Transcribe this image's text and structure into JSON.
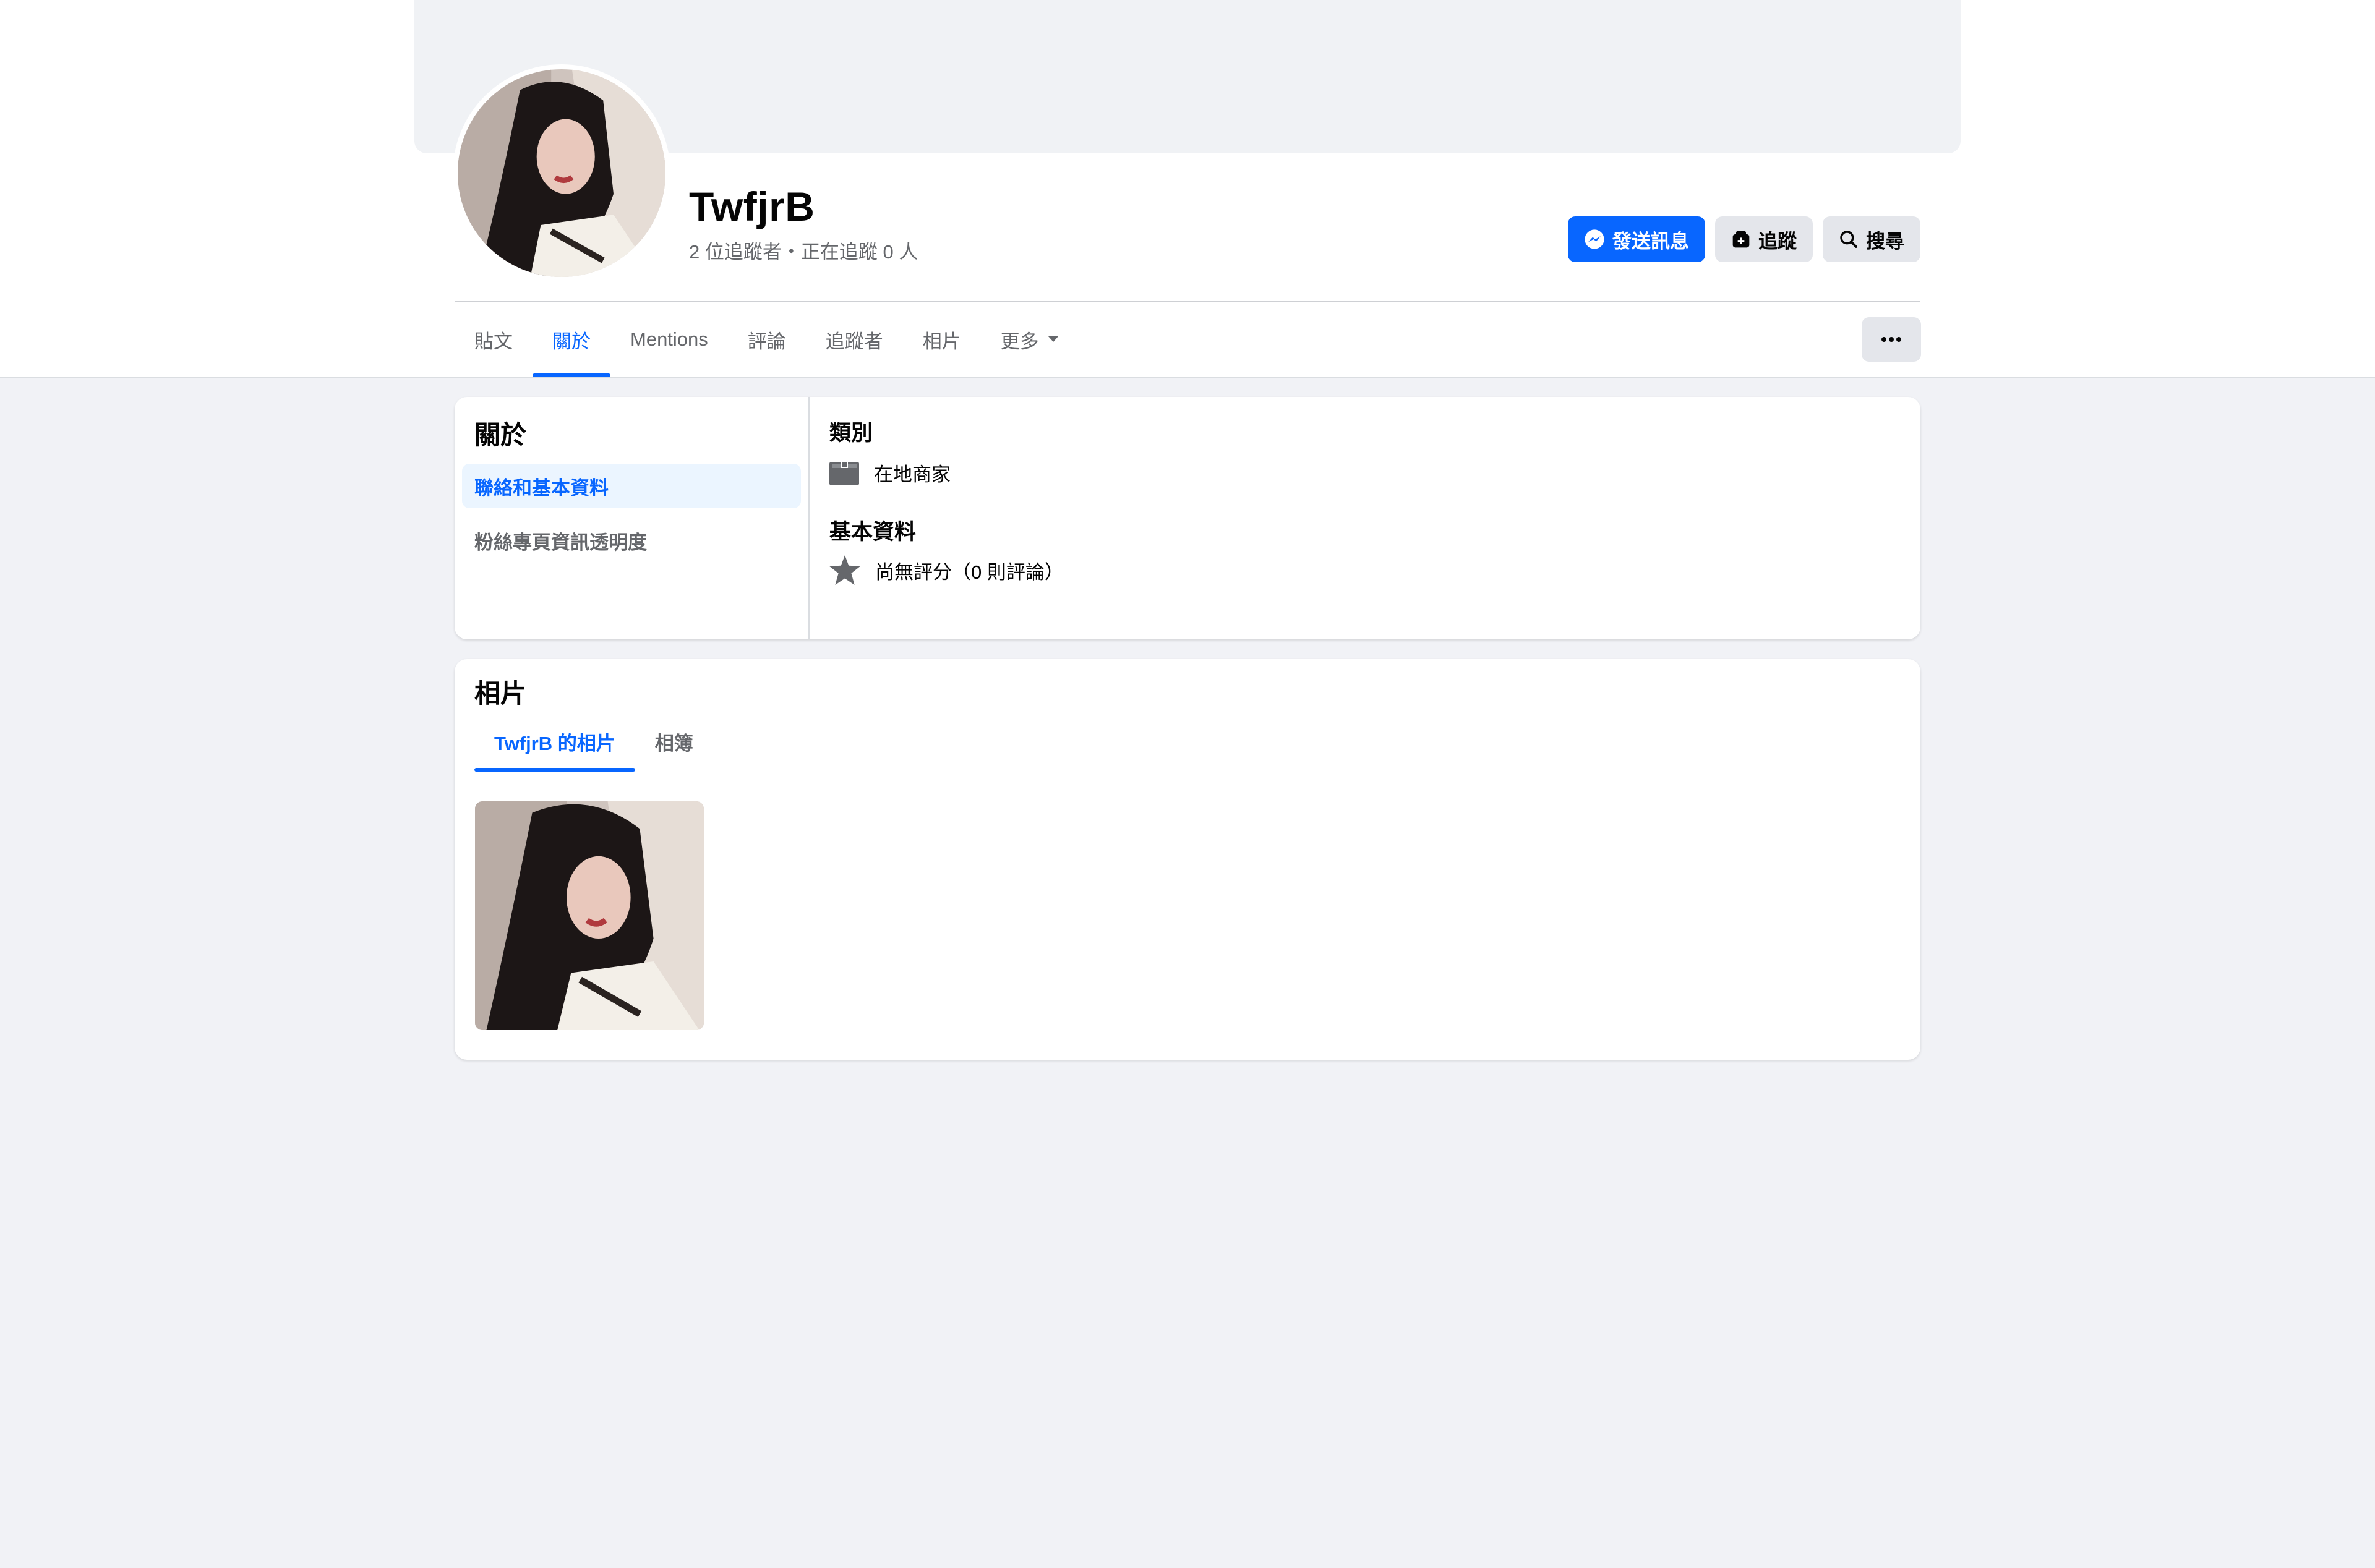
{
  "profile": {
    "name": "TwfjrB",
    "stats": "2 位追蹤者・正在追蹤 0 人"
  },
  "actions": {
    "message_label": "發送訊息",
    "follow_label": "追蹤",
    "search_label": "搜尋"
  },
  "tabs": [
    {
      "label": "貼文",
      "active": false
    },
    {
      "label": "關於",
      "active": true
    },
    {
      "label": "Mentions",
      "active": false
    },
    {
      "label": "評論",
      "active": false
    },
    {
      "label": "追蹤者",
      "active": false
    },
    {
      "label": "相片",
      "active": false
    },
    {
      "label": "更多",
      "active": false
    }
  ],
  "about": {
    "title": "關於",
    "nav": [
      {
        "label": "聯絡和基本資料",
        "active": true
      },
      {
        "label": "粉絲專頁資訊透明度",
        "active": false
      }
    ],
    "category_title": "類別",
    "category_value": "在地商家",
    "basic_title": "基本資料",
    "rating_value": "尚無評分（0 則評論）"
  },
  "photos": {
    "title": "相片",
    "tabs": [
      {
        "label": "TwfjrB 的相片",
        "active": true
      },
      {
        "label": "相簿",
        "active": false
      }
    ]
  },
  "colors": {
    "accent": "#0866ff",
    "page_bg": "#f1f2f6",
    "text_secondary": "#65676b"
  },
  "icons": {
    "message": "messenger-icon",
    "follow": "follow-icon",
    "search": "search-icon",
    "more": "ellipsis-icon",
    "category": "category-box-icon",
    "rating": "star-icon",
    "dropdown": "caret-down-icon"
  }
}
